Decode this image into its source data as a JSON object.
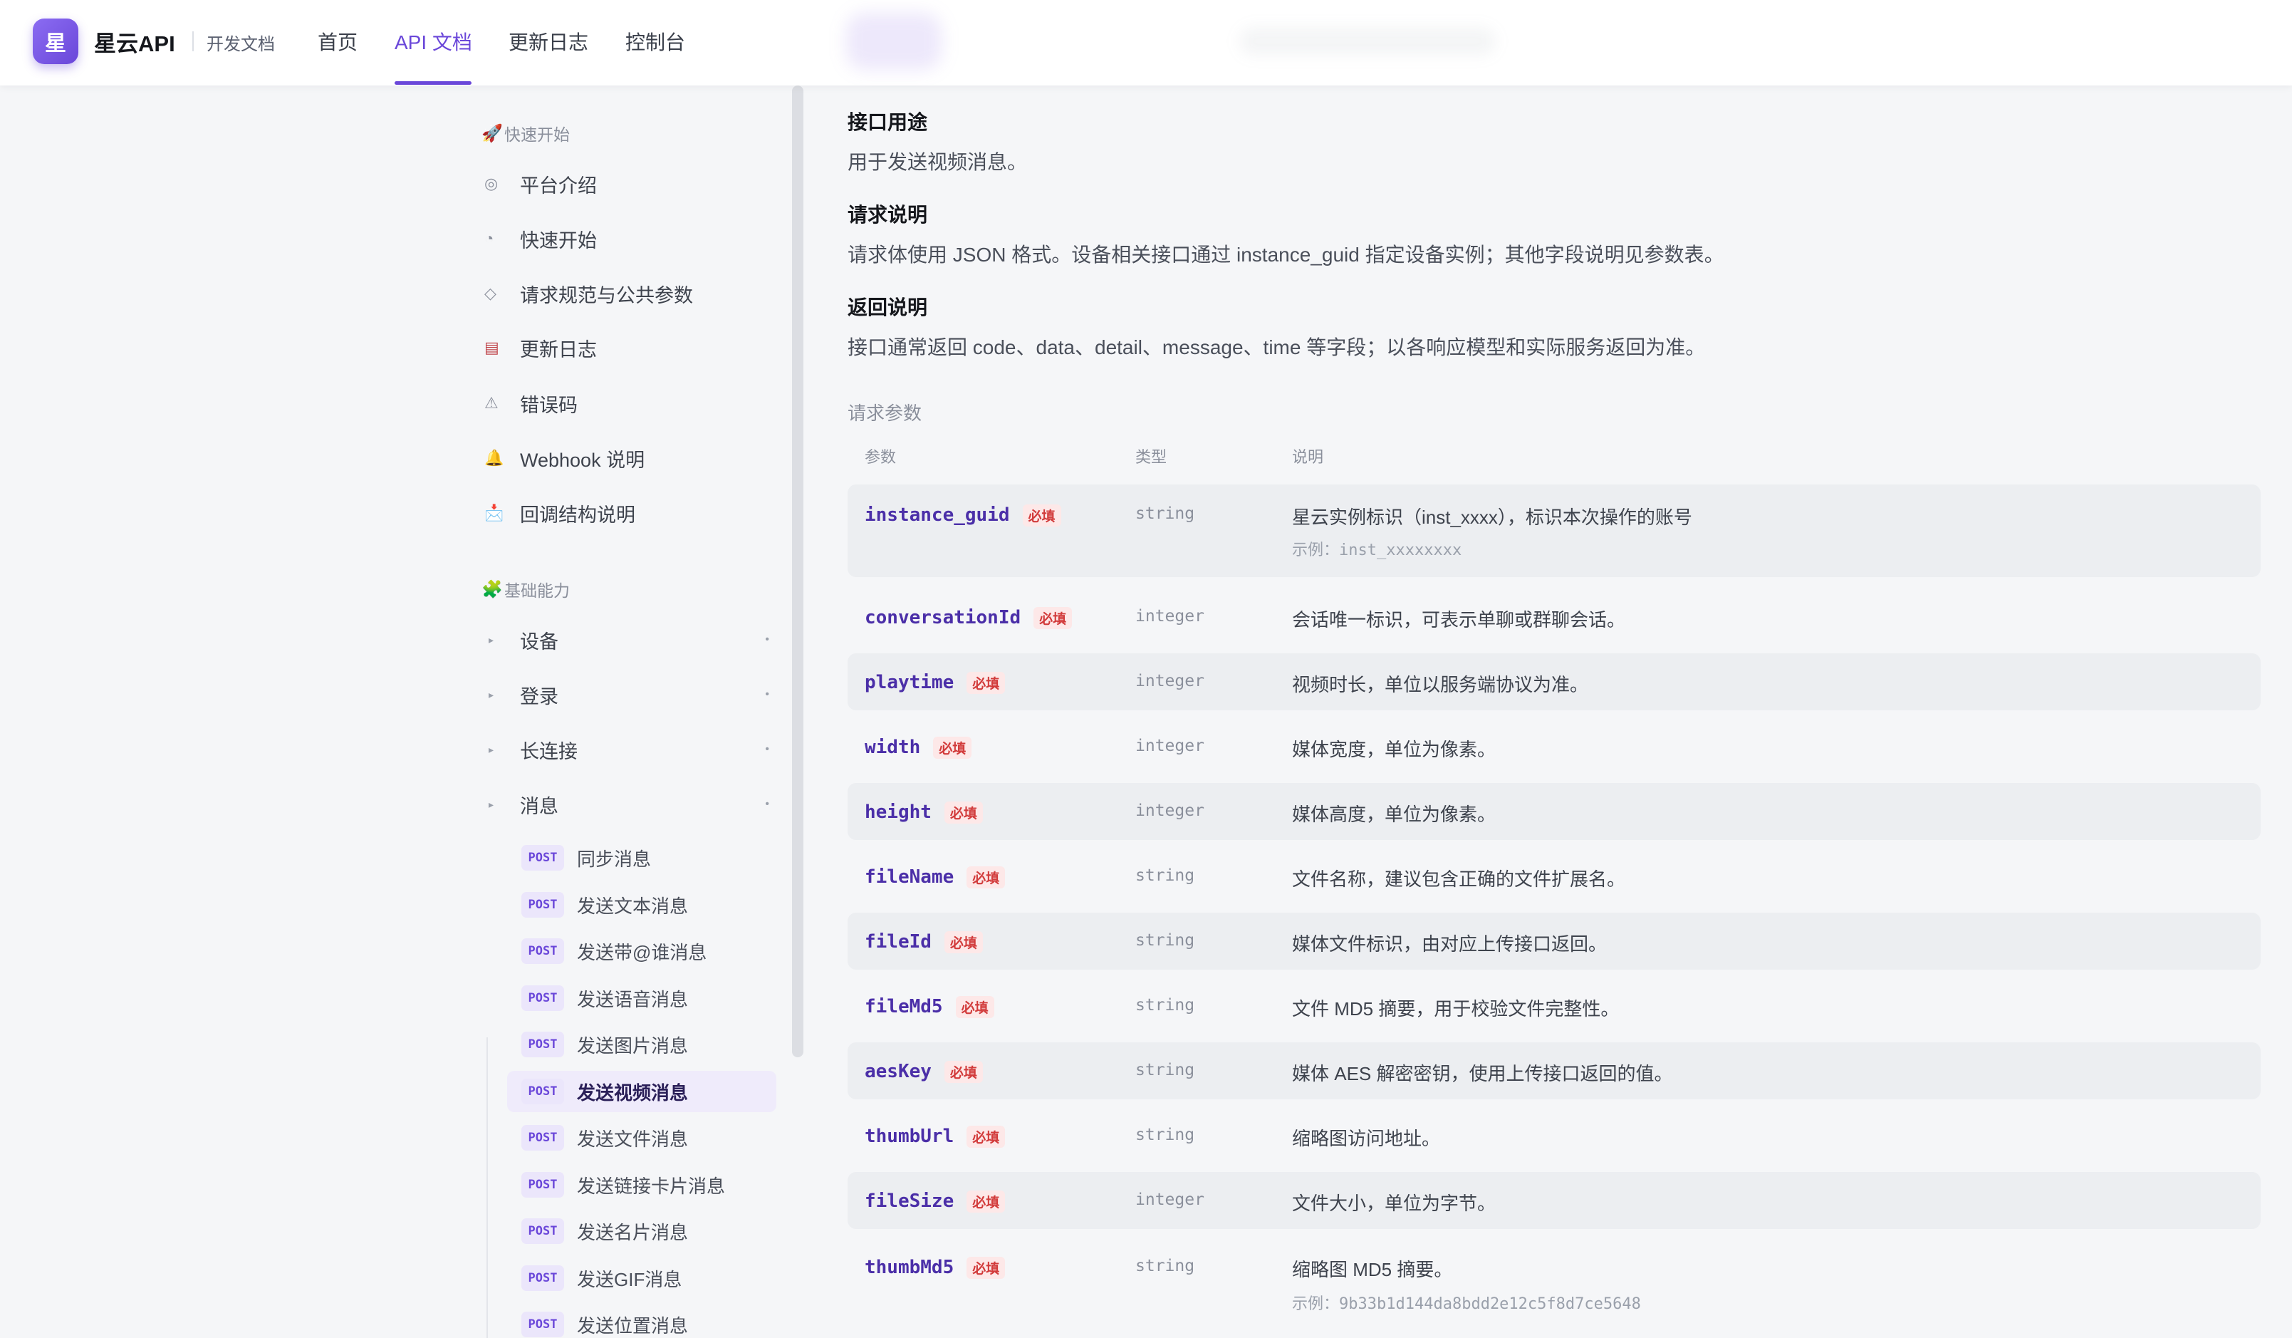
{
  "header": {
    "logo_char": "星",
    "brand": "星云API",
    "subtitle": "开发文档",
    "nav": [
      {
        "label": "首页"
      },
      {
        "label": "API 文档"
      },
      {
        "label": "更新日志"
      },
      {
        "label": "控制台"
      }
    ],
    "active_nav": "API 文档",
    "accent_color": "#6a47d9"
  },
  "sidebar": {
    "quickstart_title": "快速开始",
    "quickstart_icon": "rocket-icon",
    "quickstart_items": [
      {
        "label": "平台介绍",
        "icon": "target-icon"
      },
      {
        "label": "快速开始",
        "icon": "clock-icon"
      },
      {
        "label": "请求规范与公共参数",
        "icon": "diamond-icon"
      },
      {
        "label": "更新日志",
        "icon": "calendar-icon"
      },
      {
        "label": "错误码",
        "icon": "warning-icon"
      },
      {
        "label": "Webhook 说明",
        "icon": "bell-icon"
      },
      {
        "label": "回调结构说明",
        "icon": "inbox-icon"
      }
    ],
    "basic_title": "基础能力",
    "basic_icon": "puzzle-icon",
    "basic_groups": [
      {
        "label": "设备"
      },
      {
        "label": "登录"
      },
      {
        "label": "长连接"
      },
      {
        "label": "消息"
      }
    ],
    "method_label": "POST",
    "message_items": [
      {
        "label": "同步消息"
      },
      {
        "label": "发送文本消息"
      },
      {
        "label": "发送带@谁消息"
      },
      {
        "label": "发送语音消息"
      },
      {
        "label": "发送图片消息"
      },
      {
        "label": "发送视频消息"
      },
      {
        "label": "发送文件消息"
      },
      {
        "label": "发送链接卡片消息"
      },
      {
        "label": "发送名片消息"
      },
      {
        "label": "发送GIF消息"
      },
      {
        "label": "发送位置消息"
      }
    ],
    "active_item": "发送视频消息"
  },
  "content": {
    "purpose_title": "接口用途",
    "purpose_text": "用于发送视频消息。",
    "request_title": "请求说明",
    "request_text": "请求体使用 JSON 格式。设备相关接口通过 instance_guid 指定设备实例；其他字段说明见参数表。",
    "response_title": "返回说明",
    "response_text": "接口通常返回 code、data、detail、message、time 等字段；以各响应模型和实际服务返回为准。",
    "params_title": "请求参数",
    "columns": {
      "name": "参数",
      "type": "类型",
      "desc": "说明"
    },
    "required_label": "必填",
    "example_prefix": "示例：",
    "params": [
      {
        "name": "instance_guid",
        "type": "string",
        "desc": "星云实例标识（inst_xxxx），标识本次操作的账号",
        "example": "inst_xxxxxxxx"
      },
      {
        "name": "conversationId",
        "type": "integer",
        "desc": "会话唯一标识，可表示单聊或群聊会话。"
      },
      {
        "name": "playtime",
        "type": "integer",
        "desc": "视频时长，单位以服务端协议为准。"
      },
      {
        "name": "width",
        "type": "integer",
        "desc": "媒体宽度，单位为像素。"
      },
      {
        "name": "height",
        "type": "integer",
        "desc": "媒体高度，单位为像素。"
      },
      {
        "name": "fileName",
        "type": "string",
        "desc": "文件名称，建议包含正确的文件扩展名。"
      },
      {
        "name": "fileId",
        "type": "string",
        "desc": "媒体文件标识，由对应上传接口返回。"
      },
      {
        "name": "fileMd5",
        "type": "string",
        "desc": "文件 MD5 摘要，用于校验文件完整性。"
      },
      {
        "name": "aesKey",
        "type": "string",
        "desc": "媒体 AES 解密密钥，使用上传接口返回的值。"
      },
      {
        "name": "thumbUrl",
        "type": "string",
        "desc": "缩略图访问地址。"
      },
      {
        "name": "fileSize",
        "type": "integer",
        "desc": "文件大小，单位为字节。"
      },
      {
        "name": "thumbMd5",
        "type": "string",
        "desc": "缩略图 MD5 摘要。",
        "example": "9b33b1d144da8bdd2e12c5f8d7ce5648"
      }
    ]
  }
}
